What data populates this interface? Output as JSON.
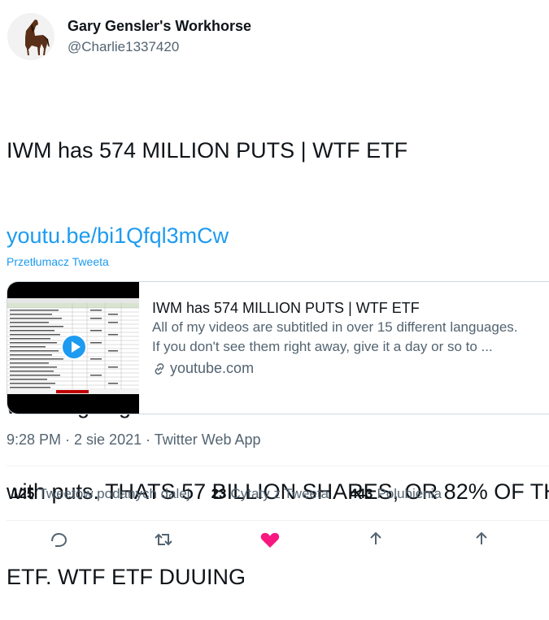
{
  "author": {
    "name": "Gary Gensler's Workhorse",
    "handle": "@Charlie1337420"
  },
  "tweet": {
    "line1": "IWM has 574 MILLION PUTS | WTF ETF",
    "link": "youtu.be/bi1Qfql3mCw",
    "line3": "wTF is going on with IWM.. IJR is not at all this loaded",
    "line4": "with puts. THATS 57 BILLION SHARES, OR 82% OF THE",
    "line5": "ETF. WTF ETF DUUING"
  },
  "translate_label": "Przetłumacz Tweeta",
  "card": {
    "title": "IWM has 574 MILLION PUTS | WTF ETF",
    "desc1": "All of my videos are subtitled in over 15 different languages.",
    "desc2": "If you don't see them right away, give it a day or so to ...",
    "domain": "youtube.com"
  },
  "meta": "9:28 PM · 2 sie 2021 · Twitter Web App",
  "stats": [
    {
      "count": "125",
      "label": "Tweetów podanych dalej"
    },
    {
      "count": "23",
      "label": "Cytaty z Tweeta"
    },
    {
      "count": "443",
      "label": "Polubienia"
    }
  ],
  "icons": [
    "horse-avatar",
    "play-icon",
    "link-icon",
    "reply-icon",
    "retweet-icon",
    "like-icon",
    "share-icon"
  ],
  "colors": {
    "accent": "#1d9bf0",
    "like": "#f91880",
    "secondary_text": "#536471"
  }
}
